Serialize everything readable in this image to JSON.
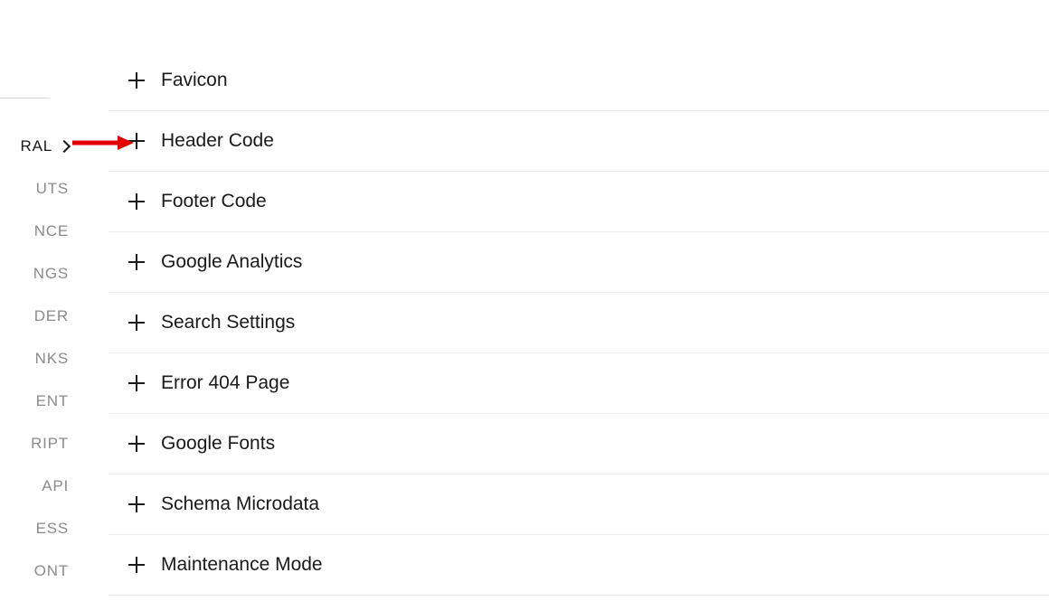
{
  "sidebar": {
    "items": [
      {
        "label": "RAL",
        "active": true
      },
      {
        "label": "UTS",
        "active": false
      },
      {
        "label": "NCE",
        "active": false
      },
      {
        "label": "NGS",
        "active": false
      },
      {
        "label": "DER",
        "active": false
      },
      {
        "label": "NKS",
        "active": false
      },
      {
        "label": "ENT",
        "active": false
      },
      {
        "label": "RIPT",
        "active": false
      },
      {
        "label": " API",
        "active": false
      },
      {
        "label": "ESS",
        "active": false
      },
      {
        "label": "ONT",
        "active": false
      }
    ]
  },
  "panels": [
    {
      "label": "Favicon"
    },
    {
      "label": "Header Code"
    },
    {
      "label": "Footer Code"
    },
    {
      "label": "Google Analytics"
    },
    {
      "label": "Search Settings"
    },
    {
      "label": "Error 404 Page"
    },
    {
      "label": "Google Fonts"
    },
    {
      "label": "Schema Microdata"
    },
    {
      "label": "Maintenance Mode"
    }
  ],
  "annotation": {
    "arrow_color": "#e30000"
  }
}
